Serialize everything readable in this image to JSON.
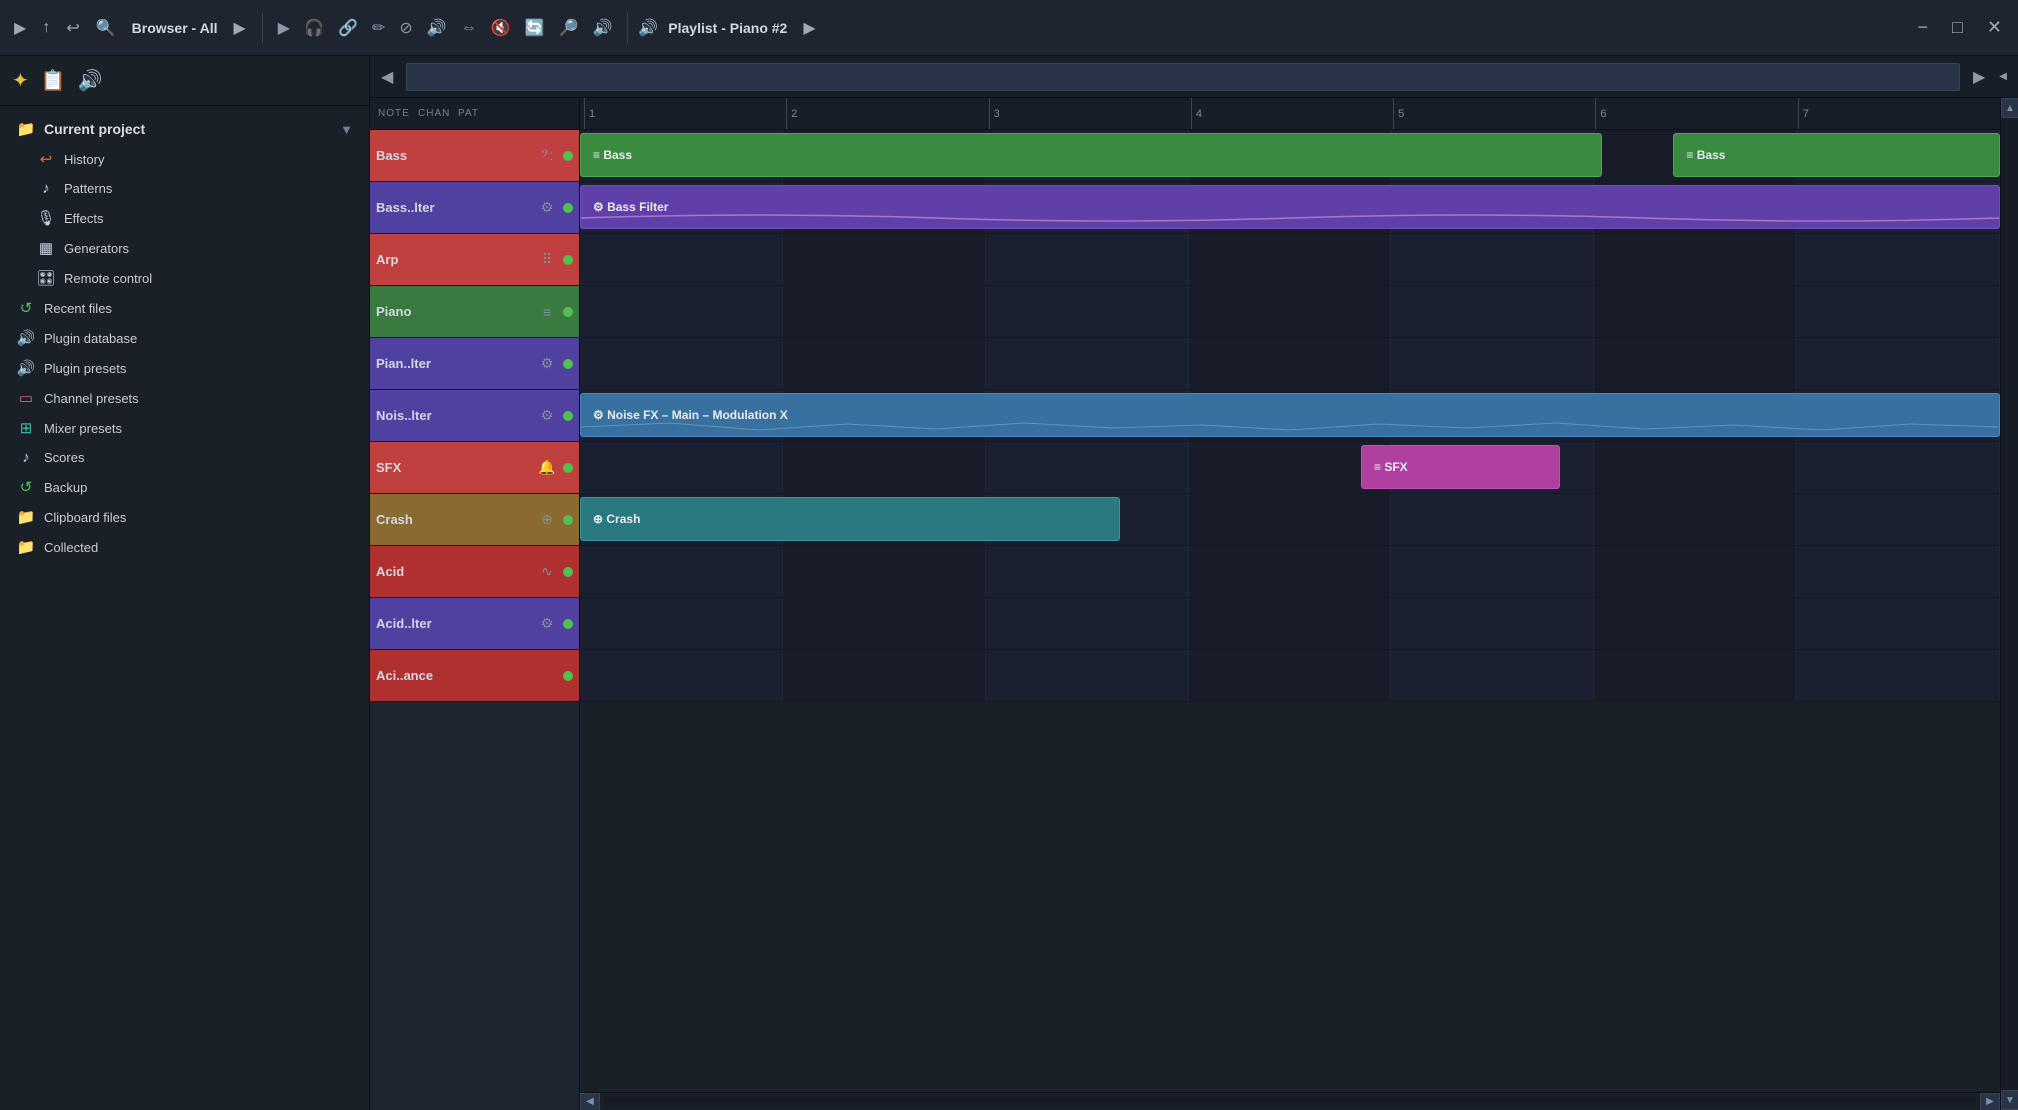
{
  "app": {
    "title": "Browser - All",
    "playlist_title": "Playlist - Piano #2"
  },
  "top_toolbar": {
    "play_btn": "▶",
    "browser_label": "Browser - All",
    "playlist_label": "Playlist - Piano #2",
    "nav_prev": "◀",
    "nav_next": "▶",
    "minimize": "−",
    "maximize": "□",
    "close": "✕"
  },
  "sidebar": {
    "toolbar_icons": [
      "✦",
      "📋",
      "🔊"
    ],
    "current_project_label": "Current project",
    "items": [
      {
        "id": "current-project",
        "label": "Current project",
        "icon": "📁",
        "level": 0,
        "color": "color-orange"
      },
      {
        "id": "history",
        "label": "History",
        "icon": "↩",
        "level": 1,
        "color": "color-orange"
      },
      {
        "id": "patterns",
        "label": "Patterns",
        "icon": "♪",
        "level": 1,
        "color": "color-light"
      },
      {
        "id": "effects",
        "label": "Effects",
        "icon": "🔔",
        "level": 1,
        "color": "color-light"
      },
      {
        "id": "generators",
        "label": "Generators",
        "icon": "▦",
        "level": 1,
        "color": "color-light"
      },
      {
        "id": "remote-control",
        "label": "Remote control",
        "icon": "🎛",
        "level": 1,
        "color": "color-light"
      },
      {
        "id": "recent-files",
        "label": "Recent files",
        "icon": "↺",
        "level": 0,
        "color": "color-green"
      },
      {
        "id": "plugin-database",
        "label": "Plugin database",
        "icon": "🔊",
        "level": 0,
        "color": "color-blue"
      },
      {
        "id": "plugin-presets",
        "label": "Plugin presets",
        "icon": "🔊",
        "level": 0,
        "color": "color-purple"
      },
      {
        "id": "channel-presets",
        "label": "Channel presets",
        "icon": "▭",
        "level": 0,
        "color": "color-pink"
      },
      {
        "id": "mixer-presets",
        "label": "Mixer presets",
        "icon": "⊞",
        "level": 0,
        "color": "color-teal"
      },
      {
        "id": "scores",
        "label": "Scores",
        "icon": "♪",
        "level": 0,
        "color": "color-light"
      },
      {
        "id": "backup",
        "label": "Backup",
        "icon": "↺",
        "level": 0,
        "color": "color-green"
      },
      {
        "id": "clipboard-files",
        "label": "Clipboard files",
        "icon": "📁",
        "level": 0,
        "color": "color-gray"
      },
      {
        "id": "collected",
        "label": "Collected",
        "icon": "📁",
        "level": 0,
        "color": "color-gray"
      }
    ]
  },
  "track_col_headers": {
    "note": "NOTE",
    "chan": "CHAN",
    "pat": "PAT"
  },
  "tracks": [
    {
      "id": "bass",
      "name": "Bass",
      "icon": "𝄢",
      "color_class": "tr-bass",
      "dot": true
    },
    {
      "id": "bass-filter",
      "name": "Bass..lter",
      "icon": "⚙",
      "color_class": "tr-bassfilter",
      "dot": true
    },
    {
      "id": "arp",
      "name": "Arp",
      "icon": "⠿",
      "color_class": "tr-arp",
      "dot": true
    },
    {
      "id": "piano",
      "name": "Piano",
      "icon": "≡",
      "color_class": "tr-piano",
      "dot": true
    },
    {
      "id": "piano-filter",
      "name": "Pian..lter",
      "icon": "⚙",
      "color_class": "tr-pianofilter",
      "dot": true
    },
    {
      "id": "nois-filter",
      "name": "Nois..lter",
      "icon": "⚙",
      "color_class": "tr-noisfilter",
      "dot": true
    },
    {
      "id": "sfx",
      "name": "SFX",
      "icon": "🔔",
      "color_class": "tr-sfx",
      "dot": true
    },
    {
      "id": "crash",
      "name": "Crash",
      "icon": "⊕",
      "color_class": "tr-crash",
      "dot": true
    },
    {
      "id": "acid",
      "name": "Acid",
      "icon": "∿",
      "color_class": "tr-acid",
      "dot": true
    },
    {
      "id": "acid-filter",
      "name": "Acid..lter",
      "icon": "⚙",
      "color_class": "tr-acidfilter",
      "dot": true
    },
    {
      "id": "aciance",
      "name": "Aci..ance",
      "icon": "",
      "color_class": "tr-aciance",
      "dot": true
    }
  ],
  "ruler": {
    "marks": [
      "1",
      "2",
      "3",
      "4",
      "5",
      "6",
      "7"
    ]
  },
  "patterns": [
    {
      "id": "bass-1",
      "label": "≡ Bass",
      "track": 0,
      "start_pct": 0,
      "width_pct": 72,
      "color": "pb-green"
    },
    {
      "id": "bass-2",
      "label": "≡ Bass",
      "track": 0,
      "start_pct": 77,
      "width_pct": 23,
      "color": "pb-green"
    },
    {
      "id": "bass-filter-1",
      "label": "⚙ Bass Filter",
      "track": 1,
      "start_pct": 0,
      "width_pct": 100,
      "color": "pb-purple"
    },
    {
      "id": "noise-fx-1",
      "label": "⚙ Noise FX – Main – Modulation X",
      "track": 5,
      "start_pct": 0,
      "width_pct": 100,
      "color": "pb-blue"
    },
    {
      "id": "sfx-1",
      "label": "≡ SFX",
      "track": 6,
      "start_pct": 55,
      "width_pct": 15,
      "color": "pb-pink"
    },
    {
      "id": "crash-1",
      "label": "⊕ Crash",
      "track": 7,
      "start_pct": 0,
      "width_pct": 38,
      "color": "pb-teal"
    }
  ]
}
